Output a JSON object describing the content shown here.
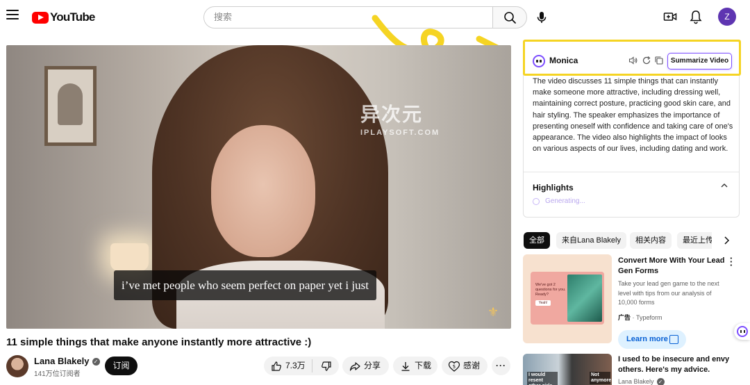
{
  "header": {
    "logo_text": "YouTube",
    "search_placeholder": "搜索",
    "avatar_letter": "Z"
  },
  "video": {
    "caption": "i’ve met people who seem perfect on paper yet i just",
    "watermark_cn": "异次元",
    "watermark_en": "IPLAYSOFT.COM",
    "title": "11 simple things that make anyone instantly more attractive :)",
    "channel": "Lana Blakely",
    "subscribers": "141万位订阅者",
    "subscribe_label": "订阅",
    "like_count": "7.3万",
    "share_label": "分享",
    "download_label": "下载",
    "thanks_label": "感谢",
    "more_label": "···"
  },
  "monica": {
    "name": "Monica",
    "summarize_label": "Summarize Video",
    "summary": "The video discusses 11 simple things that can instantly make someone more attractive, including dressing well, maintaining correct posture, practicing good skin care, and hair styling. The speaker emphasizes the importance of presenting oneself with confidence and taking care of one's appearance. The video also highlights the impact of looks on various aspects of our lives, including dating and work.",
    "highlights_title": "Highlights",
    "generating": "Generating..."
  },
  "chips": [
    "全部",
    "来自Lana Blakely",
    "相关内容",
    "最近上传"
  ],
  "ad": {
    "thumb_text": "We've got 2 questions for you. Ready?",
    "thumb_btn": "Yeah!",
    "title": "Convert More With Your Lead Gen Forms",
    "description": "Take your lead gen game to the next level with tips from our analysis of 10,000 forms",
    "label_ad": "广告",
    "label_sep": " · ",
    "advertiser": "Typeform",
    "cta": "Learn more"
  },
  "related": {
    "thumb_text_1": "I would resent other girls",
    "thumb_text_2": "Not anymore",
    "title": "I used to be insecure and envy others. Here's my advice.",
    "channel": "Lana Blakely"
  },
  "colors": {
    "brand_red": "#ff0000",
    "monica_purple": "#7c4dff",
    "highlight_yellow": "#f5d423",
    "link_blue": "#065fd4"
  }
}
